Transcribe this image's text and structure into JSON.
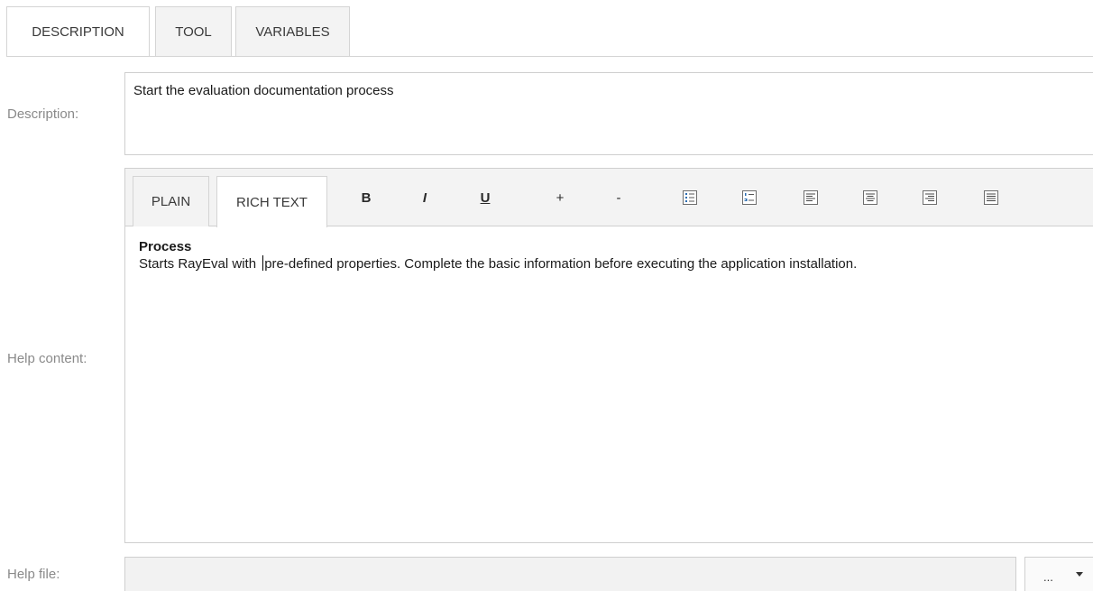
{
  "top_tabs": [
    {
      "label": "DESCRIPTION",
      "active": true
    },
    {
      "label": "TOOL",
      "active": false
    },
    {
      "label": "VARIABLES",
      "active": false
    }
  ],
  "description": {
    "label": "Description:",
    "value": "Start the evaluation documentation process"
  },
  "help_content": {
    "label": "Help content:",
    "mode_tabs": [
      {
        "label": "PLAIN",
        "active": false
      },
      {
        "label": "RICH TEXT",
        "active": true
      }
    ],
    "toolbar": {
      "bold": "B",
      "italic": "I",
      "underline": "U",
      "increase": "+",
      "decrease": "-",
      "icons": [
        "bulleted-list-icon",
        "numbered-list-icon",
        "align-left-icon",
        "align-center-icon",
        "align-right-icon",
        "justify-icon"
      ]
    },
    "heading": "Process",
    "body_before_caret": "Starts RayEval with ",
    "body_after_caret": "pre-defined properties. Complete the basic information before executing the application installation."
  },
  "help_file": {
    "label": "Help file:",
    "value": "",
    "browse_label": "..."
  }
}
